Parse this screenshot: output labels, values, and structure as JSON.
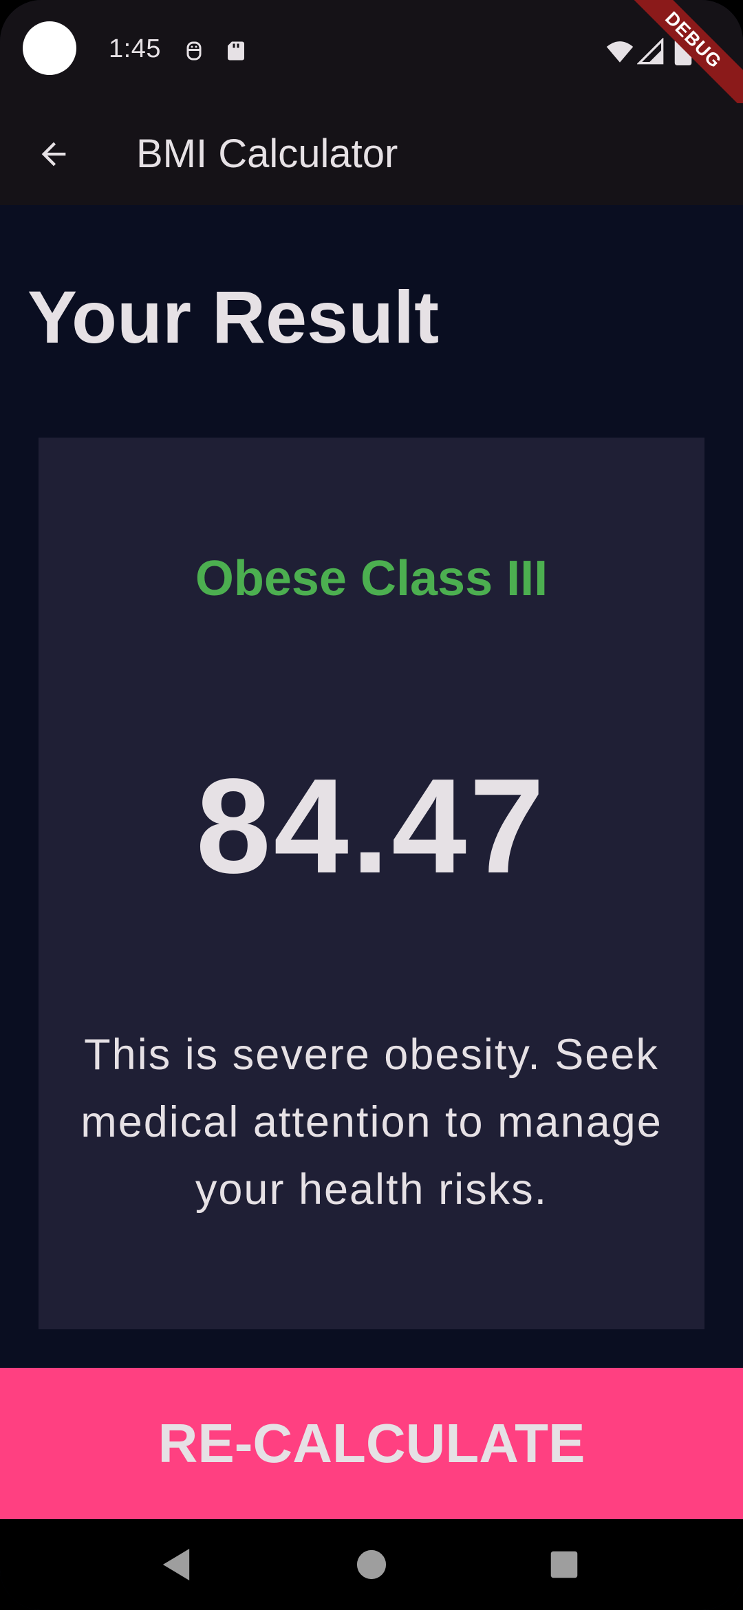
{
  "status_bar": {
    "time": "1:45",
    "icons": [
      "camera-dot-icon",
      "face-icon",
      "sd-card-icon",
      "wifi-icon",
      "signal-icon",
      "battery-icon"
    ],
    "debug_label": "DEBUG"
  },
  "app_bar": {
    "title": "BMI Calculator",
    "back_icon": "arrow-back-icon"
  },
  "page": {
    "title": "Your Result"
  },
  "result": {
    "category": "Obese Class III",
    "bmi": "84.47",
    "interpretation": "This is severe obesity. Seek medical attention to manage your health risks."
  },
  "actions": {
    "recalculate_label": "RE-CALCULATE"
  },
  "nav_bar": {
    "icons": [
      "back-triangle-icon",
      "home-circle-icon",
      "recents-square-icon"
    ]
  },
  "colors": {
    "background": "#0a0e21",
    "card": "#1f1f35",
    "category_accent": "#4caf50",
    "button": "#ff4081",
    "text": "#e6e1e5"
  }
}
